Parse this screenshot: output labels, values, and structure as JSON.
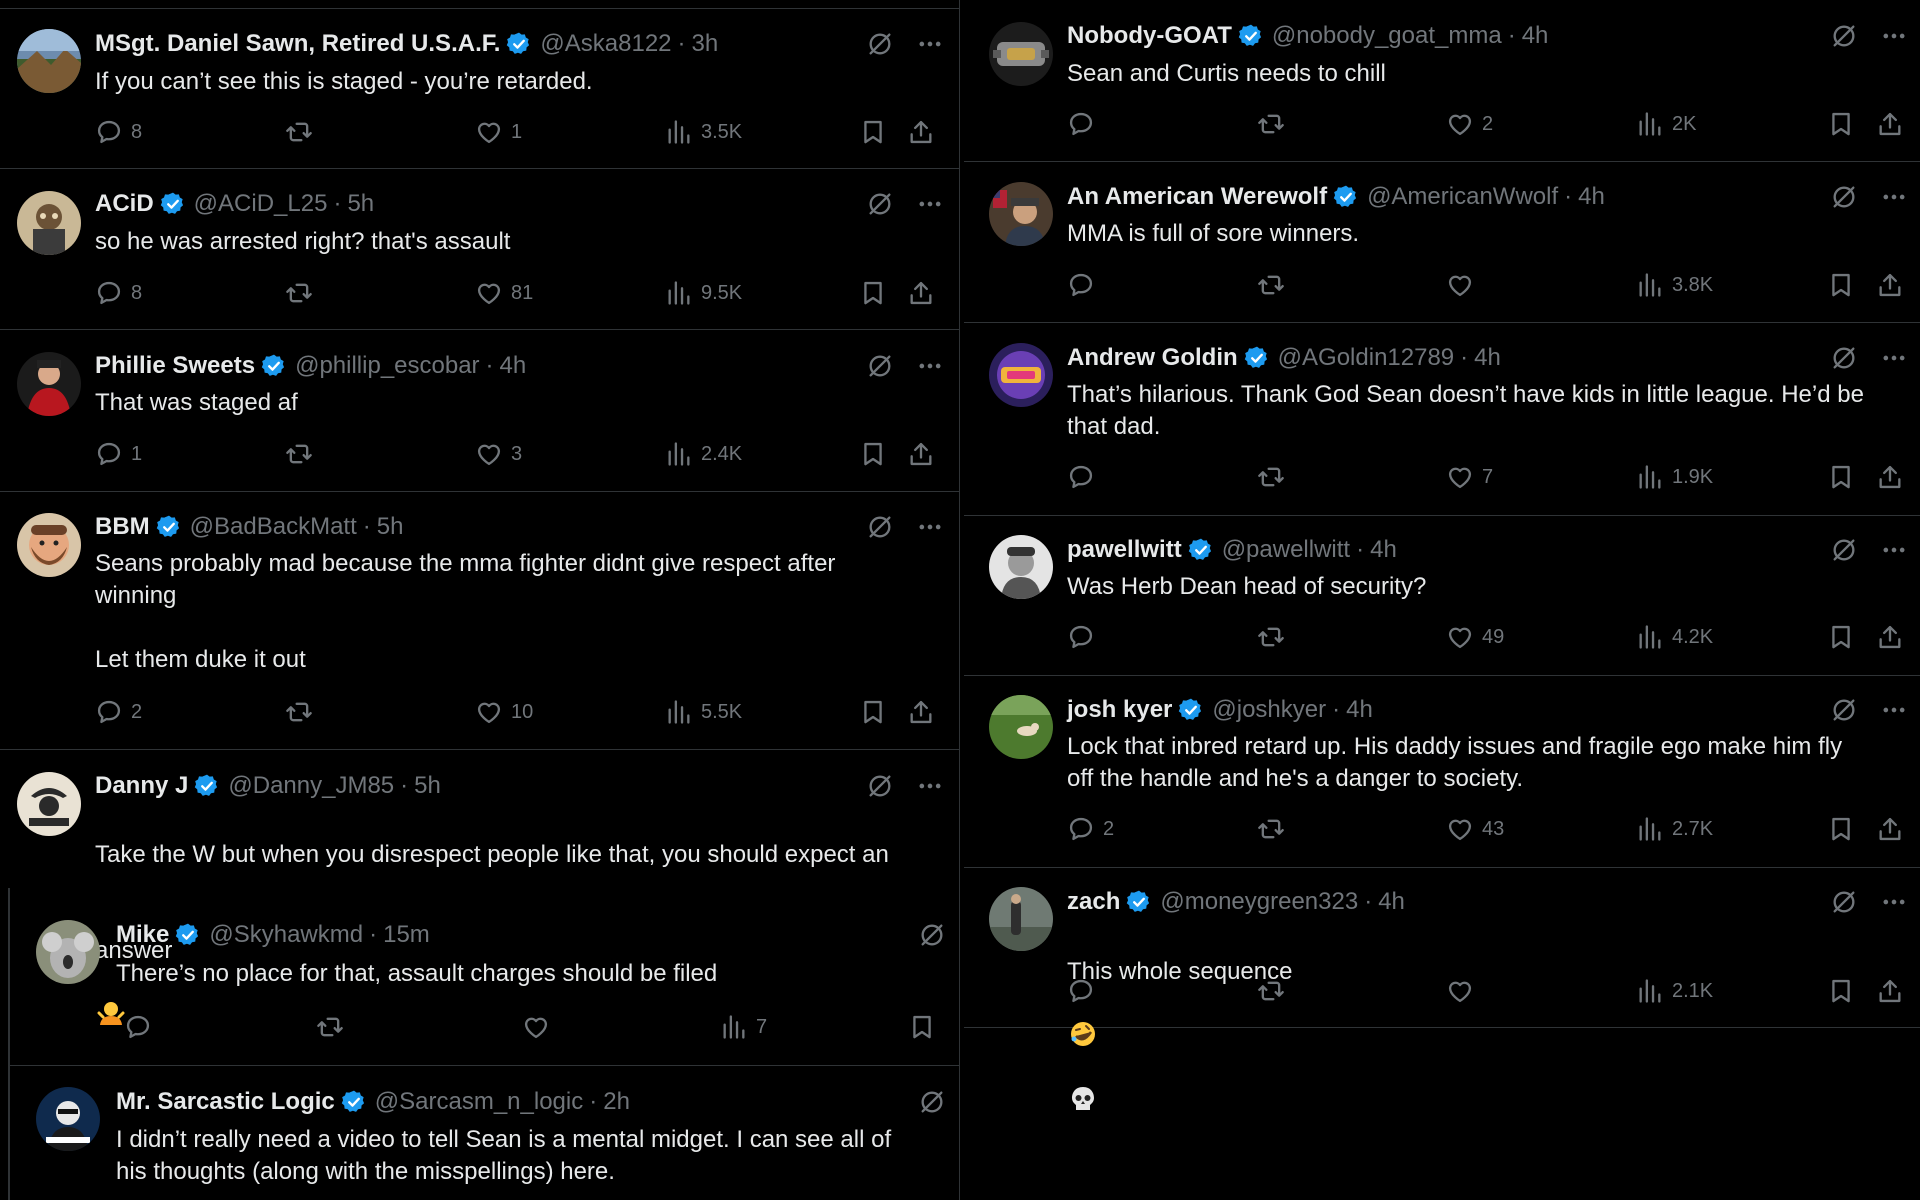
{
  "left_column": [
    {
      "name": "MSgt. Daniel Sawn, Retired U.S.A.F.",
      "handle": "@Aska8122",
      "sep": "·",
      "time": "3h",
      "text": "If you can’t see this is staged - you’re retarded.",
      "replies": "8",
      "retweets": "",
      "likes": "1",
      "views": "3.5K"
    },
    {
      "name": "ACiD",
      "handle": "@ACiD_L25",
      "sep": "·",
      "time": "5h",
      "text": "so he was arrested right? that's assault",
      "replies": "8",
      "retweets": "",
      "likes": "81",
      "views": "9.5K"
    },
    {
      "name": "Phillie Sweets",
      "handle": "@phillip_escobar",
      "sep": "·",
      "time": "4h",
      "text": "That was staged af",
      "replies": "1",
      "retweets": "",
      "likes": "3",
      "views": "2.4K"
    },
    {
      "name": "BBM",
      "handle": "@BadBackMatt",
      "sep": "·",
      "time": "5h",
      "text": "Seans probably mad because the mma fighter didnt give respect after\nwinning\n\nLet them duke it out",
      "replies": "2",
      "retweets": "",
      "likes": "10",
      "views": "5.5K"
    },
    {
      "name": "Danny J",
      "handle": "@Danny_JM85",
      "sep": "·",
      "time": "5h",
      "text_line1": "Take the W but when you disrespect people like that, you should expect an",
      "text_line2": "answer",
      "emoji": "person-shrugging-emoji"
    },
    {
      "name": "Mike",
      "handle": "@Skyhawkmd",
      "sep": "·",
      "time": "15m",
      "text": "There’s no place for that, assault charges should be filed",
      "replies": "",
      "retweets": "",
      "likes": "",
      "views": "7"
    },
    {
      "name": "Mr. Sarcastic Logic",
      "handle": "@Sarcasm_n_logic",
      "sep": "·",
      "time": "2h",
      "text": "I didn’t really need a video to tell Sean is a mental midget.  I can see all of\nhis thoughts (along with the misspellings) here."
    }
  ],
  "right_column": [
    {
      "name": "Nobody-GOAT",
      "handle": "@nobody_goat_mma",
      "sep": "·",
      "time": "4h",
      "text": "Sean and Curtis needs to chill",
      "replies": "",
      "retweets": "",
      "likes": "2",
      "views": "2K"
    },
    {
      "name": "An American Werewolf",
      "handle": "@AmericanWwolf",
      "sep": "·",
      "time": "4h",
      "text": "MMA is full of sore winners.",
      "replies": "",
      "retweets": "",
      "likes": "",
      "views": "3.8K"
    },
    {
      "name": "Andrew Goldin",
      "handle": "@AGoldin12789",
      "sep": "·",
      "time": "4h",
      "text": "That’s hilarious. Thank God Sean doesn’t have kids in little league. He’d be\nthat dad.",
      "replies": "",
      "retweets": "",
      "likes": "7",
      "views": "1.9K"
    },
    {
      "name": "pawellwitt",
      "handle": "@pawellwitt",
      "sep": "·",
      "time": "4h",
      "text": "Was Herb Dean head of security?",
      "replies": "",
      "retweets": "",
      "likes": "49",
      "views": "4.2K"
    },
    {
      "name": "josh kyer",
      "handle": "@joshkyer",
      "sep": "·",
      "time": "4h",
      "text": "Lock that inbred retard up. His daddy issues and fragile ego make him fly\noff the handle and he's a danger to society.",
      "replies": "2",
      "retweets": "",
      "likes": "43",
      "views": "2.7K"
    },
    {
      "name": "zach",
      "handle": "@moneygreen323",
      "sep": "·",
      "time": "4h",
      "text": "This whole sequence",
      "emoji1": "rolling-on-floor-laughing-emoji",
      "emoji2": "skull-emoji",
      "replies": "",
      "retweets": "",
      "likes": "",
      "views": "2.1K"
    }
  ],
  "colors": {
    "background": "#000000",
    "text_primary": "#e7e9ea",
    "text_secondary": "#71767b",
    "divider": "#2f3336",
    "verified_blue": "#1d9bf0"
  },
  "icons": {
    "verified": "verified-badge-icon",
    "grok": "grok-icon",
    "more": "more-icon",
    "reply": "reply-icon",
    "retweet": "retweet-icon",
    "like": "like-icon",
    "views": "views-icon",
    "bookmark": "bookmark-icon",
    "share": "share-icon"
  }
}
